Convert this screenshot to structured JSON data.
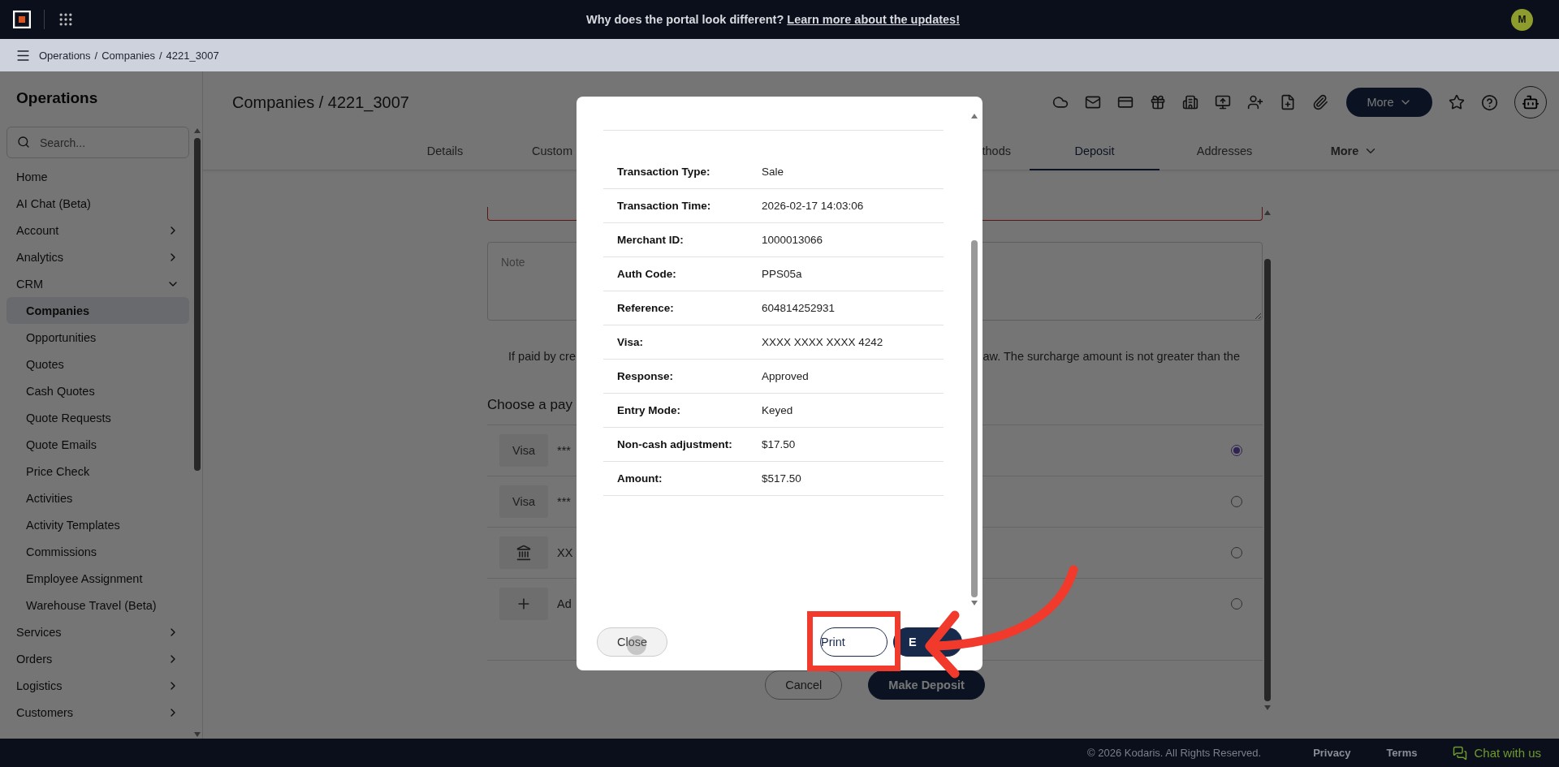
{
  "top_bar": {
    "banner_text": "Why does the portal look different?",
    "banner_link": "Learn more about the updates!",
    "avatar": "M"
  },
  "breadcrumb": {
    "separator": "/",
    "items": [
      "Operations",
      "Companies",
      "4221_3007"
    ]
  },
  "sidebar": {
    "title": "Operations",
    "search_placeholder": "Search...",
    "items": [
      {
        "label": "Home",
        "selected": false
      },
      {
        "label": "AI Chat (Beta)",
        "selected": false
      },
      {
        "label": "Account",
        "selected": false,
        "expanded": false
      },
      {
        "label": "Analytics",
        "selected": false,
        "expanded": false
      },
      {
        "label": "CRM",
        "selected": false,
        "expanded": true,
        "children": [
          {
            "label": "Companies",
            "selected": true
          },
          {
            "label": "Opportunities",
            "selected": false
          },
          {
            "label": "Quotes",
            "selected": false
          },
          {
            "label": "Cash Quotes",
            "selected": false
          },
          {
            "label": "Quote Requests",
            "selected": false
          },
          {
            "label": "Quote Emails",
            "selected": false
          },
          {
            "label": "Price Check",
            "selected": false
          },
          {
            "label": "Activities",
            "selected": false
          },
          {
            "label": "Activity Templates",
            "selected": false
          },
          {
            "label": "Commissions",
            "selected": false
          },
          {
            "label": "Employee Assignment",
            "selected": false
          },
          {
            "label": "Warehouse Travel (Beta)",
            "selected": false
          }
        ]
      },
      {
        "label": "Services",
        "selected": false,
        "expanded": false
      },
      {
        "label": "Orders",
        "selected": false,
        "expanded": false
      },
      {
        "label": "Logistics",
        "selected": false,
        "expanded": false
      },
      {
        "label": "Customers",
        "selected": false,
        "expanded": false
      }
    ]
  },
  "page": {
    "title": "Companies / 4221_3007",
    "more_button": "More",
    "tabs": [
      {
        "label": "Details",
        "selected": false,
        "kind": "full"
      },
      {
        "label": "Custom",
        "selected": false,
        "kind": "cut_end"
      },
      {
        "label": "thods",
        "selected": false,
        "kind": "cut_start"
      },
      {
        "label": "Deposit",
        "selected": true,
        "kind": "full"
      },
      {
        "label": "Addresses",
        "selected": false,
        "kind": "full"
      },
      {
        "label": "More",
        "selected": false,
        "kind": "menu"
      }
    ]
  },
  "deposit": {
    "note_placeholder": "Note",
    "notice_parts": [
      "If paid by cre",
      "aw. The surcharge amount is not greater than the"
    ],
    "heading": "Choose a pay",
    "methods": [
      {
        "kind": "card",
        "badge": "Visa",
        "text": "***",
        "selected": true
      },
      {
        "kind": "card",
        "badge": "Visa",
        "text": "***",
        "selected": false
      },
      {
        "kind": "bank",
        "text": "XX",
        "selected": false
      },
      {
        "kind": "add",
        "text": "Ad",
        "selected": false
      }
    ],
    "cancel": "Cancel",
    "submit": "Make Deposit"
  },
  "modal": {
    "rows": [
      {
        "label": "Transaction Type:",
        "value": "Sale"
      },
      {
        "label": "Transaction Time:",
        "value": "2026-02-17 14:03:06"
      },
      {
        "label": "Merchant ID:",
        "value": "1000013066"
      },
      {
        "label": "Auth Code:",
        "value": "PPS05a"
      },
      {
        "label": "Reference:",
        "value": "604814252931"
      },
      {
        "label": "Visa:",
        "value": "XXXX XXXX XXXX 4242"
      },
      {
        "label": "Response:",
        "value": "Approved"
      },
      {
        "label": "Entry Mode:",
        "value": "Keyed"
      },
      {
        "label": "Non-cash adjustment:",
        "value": "$17.50"
      },
      {
        "label": "Amount:",
        "value": "$517.50"
      }
    ],
    "buttons": [
      {
        "label": "Close",
        "kind": "light"
      },
      {
        "label": "Print",
        "kind": "outline"
      },
      {
        "label": "E",
        "kind": "primary"
      }
    ]
  },
  "footer": {
    "copyright": "© 2026 Kodaris. All Rights Reserved.",
    "links": [
      "Privacy",
      "Terms"
    ],
    "chat": "Chat with us"
  }
}
